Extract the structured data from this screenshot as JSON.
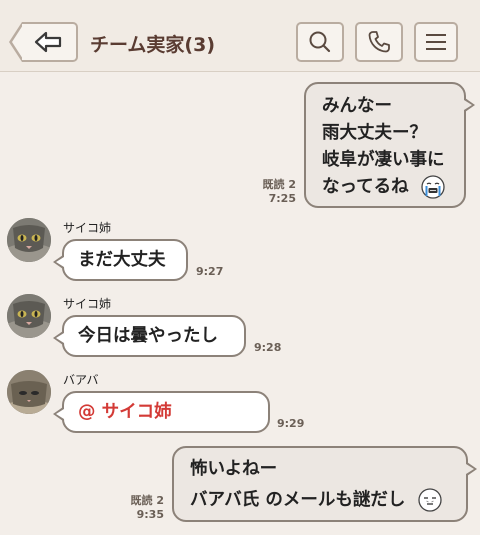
{
  "header": {
    "title": "チーム実家(3)",
    "back_icon": "back-arrow-icon",
    "search_icon": "search-icon",
    "call_icon": "phone-icon",
    "menu_icon": "menu-icon"
  },
  "messages": [
    {
      "direction": "outgoing",
      "lines": [
        "みんなー",
        "雨大丈夫ー？",
        "岐阜が凄い事に",
        "なってるね"
      ],
      "emoji": "crying-face-emoji",
      "read_label": "既読 2",
      "time": "7:25"
    },
    {
      "direction": "incoming",
      "sender": "サイコ姉",
      "avatar": "cat-avatar",
      "text": "まだ大丈夫",
      "time": "9:27"
    },
    {
      "direction": "incoming",
      "sender": "サイコ姉",
      "avatar": "cat-avatar",
      "text": "今日は曇やったし",
      "time": "9:28"
    },
    {
      "direction": "incoming",
      "sender": "バアバ",
      "avatar": "cat-avatar",
      "mention": "@ サイコ姉",
      "time": "9:29"
    },
    {
      "direction": "outgoing",
      "lines": [
        "怖いよねー",
        "バアバ氏 のメールも謎だし"
      ],
      "emoji": "neutral-face-emoji",
      "read_label": "既読 2",
      "time": "9:35"
    }
  ],
  "colors": {
    "background": "#f3eee9",
    "title": "#5a3c32",
    "mention": "#d33a36",
    "bubble_border": "#8c8279"
  }
}
